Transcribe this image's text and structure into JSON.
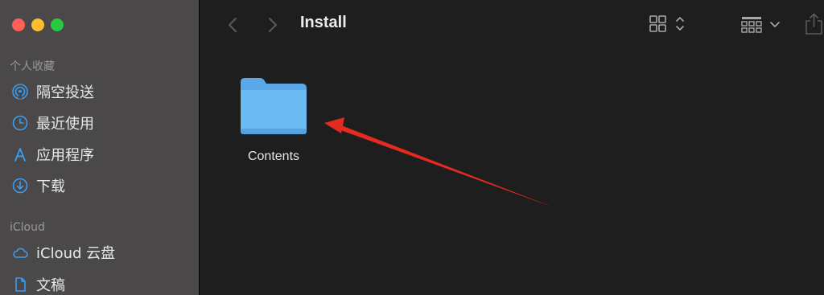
{
  "window": {
    "title": "Install"
  },
  "sidebar": {
    "favorites_title": "个人收藏",
    "favorites": [
      {
        "label": "隔空投送",
        "icon": "airdrop-icon"
      },
      {
        "label": "最近使用",
        "icon": "clock-icon"
      },
      {
        "label": "应用程序",
        "icon": "applications-icon"
      },
      {
        "label": "下载",
        "icon": "download-icon"
      }
    ],
    "icloud_title": "iCloud",
    "icloud": [
      {
        "label": "iCloud 云盘",
        "icon": "cloud-icon"
      },
      {
        "label": "文稿",
        "icon": "document-icon"
      }
    ]
  },
  "content": {
    "items": [
      {
        "name": "Contents",
        "type": "folder",
        "icon": "folder-icon"
      }
    ]
  },
  "colors": {
    "accent_blue": "#3b9cf0",
    "folder_blue": "#66b6f2",
    "annotation_arrow": "#e52a20"
  }
}
